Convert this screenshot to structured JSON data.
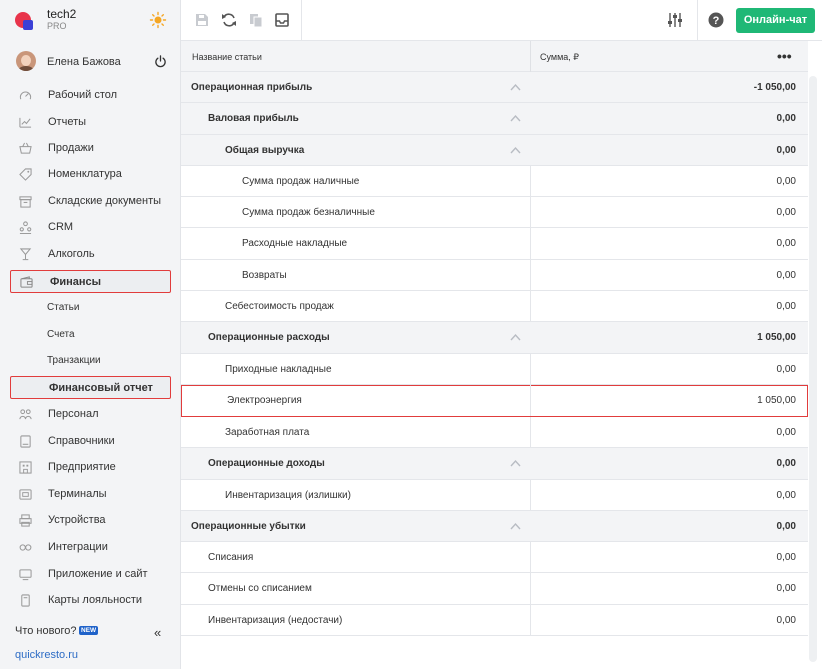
{
  "brand": {
    "name": "tech2",
    "plan": "PRO"
  },
  "user": {
    "name": "Елена Бажова"
  },
  "nav": [
    {
      "label": "Рабочий стол",
      "icon": "gauge-icon"
    },
    {
      "label": "Отчеты",
      "icon": "chart-icon"
    },
    {
      "label": "Продажи",
      "icon": "basket-icon"
    },
    {
      "label": "Номенклатура",
      "icon": "tag-icon"
    },
    {
      "label": "Складские документы",
      "icon": "warehouse-icon"
    },
    {
      "label": "CRM",
      "icon": "people-icon"
    },
    {
      "label": "Алкоголь",
      "icon": "glass-icon"
    },
    {
      "label": "Финансы",
      "icon": "wallet-icon"
    }
  ],
  "finance_sub": [
    {
      "label": "Статьи"
    },
    {
      "label": "Счета"
    },
    {
      "label": "Транзакции"
    },
    {
      "label": "Финансовый отчет"
    }
  ],
  "nav2": [
    {
      "label": "Персонал",
      "icon": "staff-icon"
    },
    {
      "label": "Справочники",
      "icon": "book-icon"
    },
    {
      "label": "Предприятие",
      "icon": "building-icon"
    },
    {
      "label": "Терминалы",
      "icon": "terminal-icon"
    },
    {
      "label": "Устройства",
      "icon": "printer-icon"
    },
    {
      "label": "Интеграции",
      "icon": "link-icon"
    },
    {
      "label": "Приложение и сайт",
      "icon": "monitor-icon"
    },
    {
      "label": "Карты лояльности",
      "icon": "card-icon"
    }
  ],
  "footer": {
    "whatsnew": "Что нового?",
    "badge": "NEW",
    "link": "quickresto.ru"
  },
  "toolbar": {
    "chat_label": "Онлайн-чат"
  },
  "table": {
    "col_name": "Название статьи",
    "col_sum": "Сумма, ₽",
    "rows": [
      {
        "name": "Операционная прибыль",
        "value": "-1 050,00",
        "level": 0,
        "group": true
      },
      {
        "name": "Валовая прибыль",
        "value": "0,00",
        "level": 1,
        "group": true
      },
      {
        "name": "Общая выручка",
        "value": "0,00",
        "level": 2,
        "group": true
      },
      {
        "name": "Сумма продаж наличные",
        "value": "0,00",
        "level": 3,
        "group": false
      },
      {
        "name": "Сумма продаж безналичные",
        "value": "0,00",
        "level": 3,
        "group": false
      },
      {
        "name": "Расходные накладные",
        "value": "0,00",
        "level": 3,
        "group": false
      },
      {
        "name": "Возвраты",
        "value": "0,00",
        "level": 3,
        "group": false
      },
      {
        "name": "Себестоимость продаж",
        "value": "0,00",
        "level": 2,
        "group": false
      },
      {
        "name": "Операционные расходы",
        "value": "1 050,00",
        "level": 1,
        "group": true
      },
      {
        "name": "Приходные накладные",
        "value": "0,00",
        "level": 2,
        "group": false
      },
      {
        "name": "Электроэнергия",
        "value": "1 050,00",
        "level": 2,
        "group": false,
        "highlight": true
      },
      {
        "name": "Заработная плата",
        "value": "0,00",
        "level": 2,
        "group": false
      },
      {
        "name": "Операционные доходы",
        "value": "0,00",
        "level": 1,
        "group": true
      },
      {
        "name": "Инвентаризация (излишки)",
        "value": "0,00",
        "level": 2,
        "group": false
      },
      {
        "name": "Операционные убытки",
        "value": "0,00",
        "level": 0,
        "group": true
      },
      {
        "name": "Списания",
        "value": "0,00",
        "level": 1,
        "group": false
      },
      {
        "name": "Отмены со списанием",
        "value": "0,00",
        "level": 1,
        "group": false
      },
      {
        "name": "Инвентаризация (недостачи)",
        "value": "0,00",
        "level": 1,
        "group": false
      }
    ]
  },
  "colors": {
    "accent": "#1fb876",
    "highlight_border": "#e13c3c",
    "link": "#2d6cc5",
    "brand_red": "#e8344b",
    "brand_blue": "#3a3fd6"
  }
}
